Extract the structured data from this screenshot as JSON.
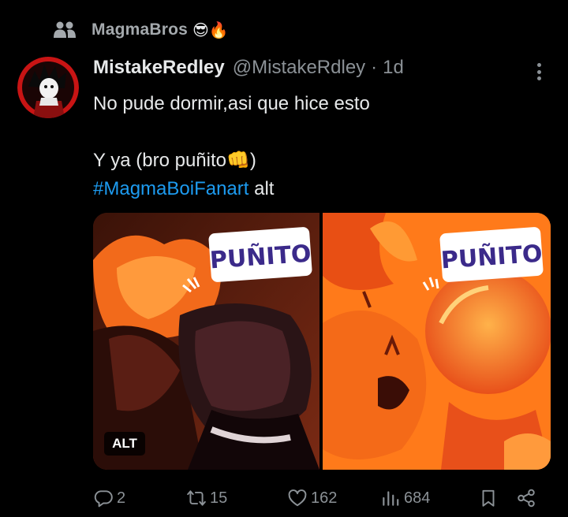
{
  "context": {
    "icon": "group-people-icon",
    "label": "MagmaBros",
    "emoji": "😎🔥"
  },
  "tweet": {
    "author_name": "MistakeRedley",
    "author_handle": "@MistakeRdley",
    "separator": "·",
    "time": "1d",
    "text_line1": "No pude dormir,asi que hice esto",
    "text_line3": "Y ya (bro puñito👊)",
    "hashtag": "#MagmaBoiFanart",
    "text_after_hashtag": " alt"
  },
  "media": {
    "image1_caption": "PUÑITO",
    "image2_caption": "PUÑITO",
    "alt_badge": "ALT"
  },
  "actions": {
    "replies": "2",
    "reposts": "15",
    "likes": "162",
    "views": "684"
  },
  "colors": {
    "background": "#000000",
    "text_primary": "#e7e9ea",
    "text_secondary": "#8b9196",
    "link": "#1d9bf0"
  }
}
